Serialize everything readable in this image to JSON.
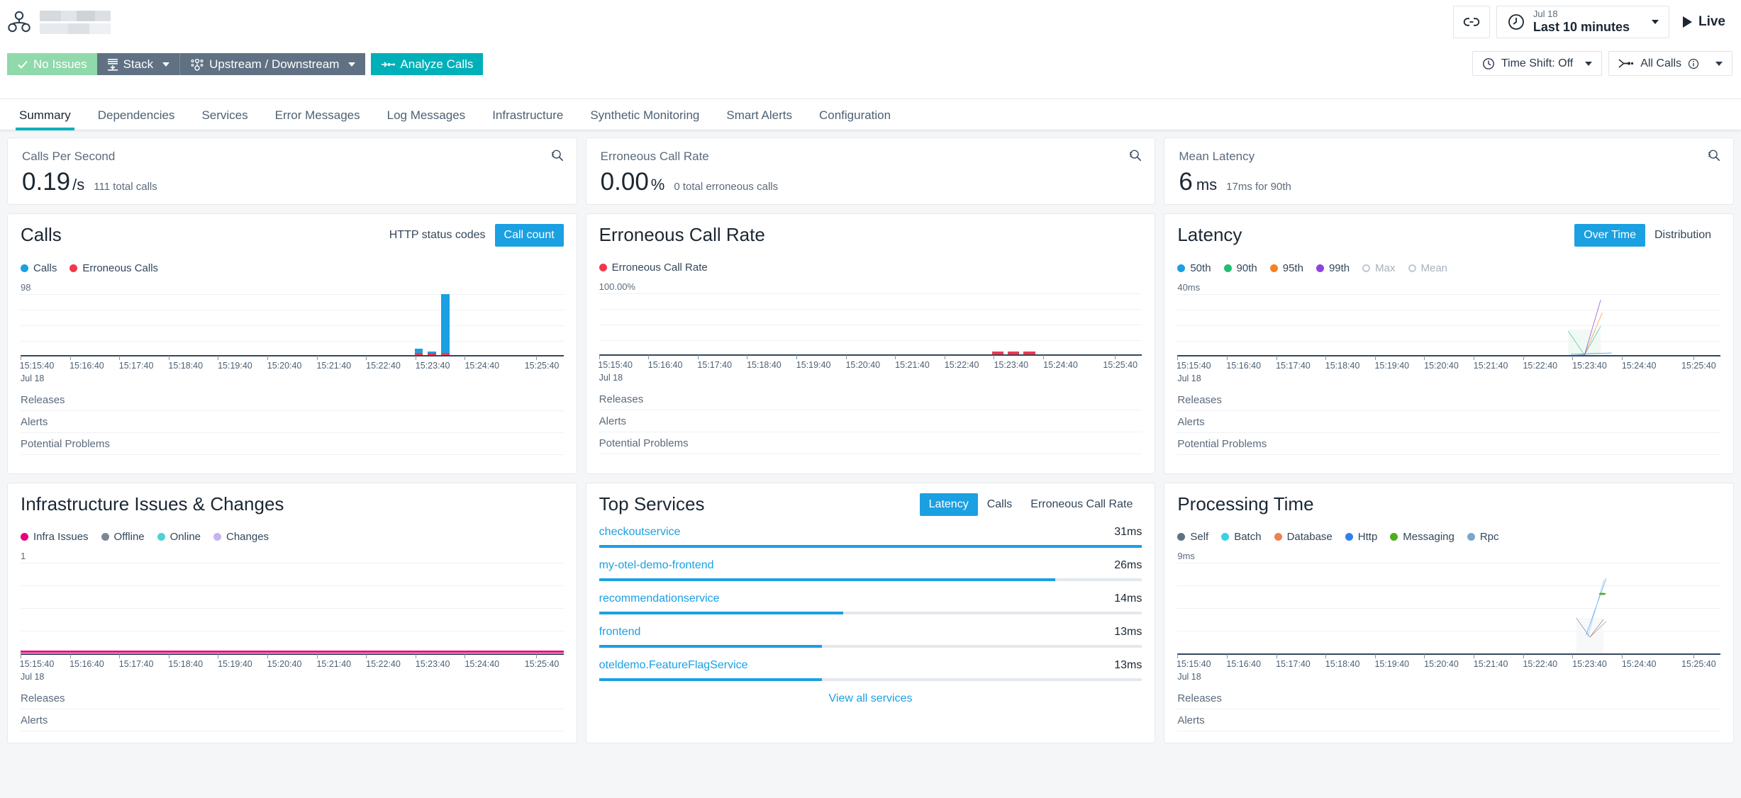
{
  "header": {
    "brand_icon": "service-topology-icon",
    "toolbar": {
      "no_issues_label": "No Issues",
      "stack_label": "Stack",
      "upstream_label": "Upstream / Downstream",
      "analyze_label": "Analyze Calls"
    },
    "right": {
      "link_icon": "chain-link-icon",
      "time_date": "Jul 18",
      "time_range": "Last 10 minutes",
      "live_label": "Live",
      "time_shift_label": "Time Shift: Off",
      "all_calls_label": "All Calls"
    }
  },
  "tabs": [
    {
      "label": "Summary",
      "active": true
    },
    {
      "label": "Dependencies",
      "active": false
    },
    {
      "label": "Services",
      "active": false
    },
    {
      "label": "Error Messages",
      "active": false
    },
    {
      "label": "Log Messages",
      "active": false
    },
    {
      "label": "Infrastructure",
      "active": false
    },
    {
      "label": "Synthetic Monitoring",
      "active": false
    },
    {
      "label": "Smart Alerts",
      "active": false
    },
    {
      "label": "Configuration",
      "active": false
    }
  ],
  "kpis": [
    {
      "title": "Calls Per Second",
      "value": "0.19",
      "unit": "/s",
      "sub": "111 total calls"
    },
    {
      "title": "Erroneous Call Rate",
      "value": "0.00",
      "unit": "%",
      "sub": "0 total erroneous calls"
    },
    {
      "title": "Mean Latency",
      "value": "6",
      "unit": "ms",
      "sub": "17ms for 90th"
    }
  ],
  "calls_card": {
    "title": "Calls",
    "toggles": [
      {
        "label": "HTTP status codes",
        "active": false
      },
      {
        "label": "Call count",
        "active": true
      }
    ],
    "legend": [
      {
        "label": "Calls",
        "color": "#1ba0e2",
        "muted": false
      },
      {
        "label": "Erroneous Calls",
        "color": "#f4364c",
        "muted": false
      }
    ],
    "axis_max": "98",
    "footer": [
      "Releases",
      "Alerts",
      "Potential Problems"
    ]
  },
  "error_card": {
    "title": "Erroneous Call Rate",
    "legend": [
      {
        "label": "Erroneous Call Rate",
        "color": "#f4364c",
        "muted": false
      }
    ],
    "axis_max": "100.00%",
    "footer": [
      "Releases",
      "Alerts",
      "Potential Problems"
    ]
  },
  "latency_card": {
    "title": "Latency",
    "toggles": [
      {
        "label": "Over Time",
        "active": true
      },
      {
        "label": "Distribution",
        "active": false
      }
    ],
    "legend": [
      {
        "label": "50th",
        "color": "#1ba0e2",
        "muted": false
      },
      {
        "label": "90th",
        "color": "#1fbf6e",
        "muted": false
      },
      {
        "label": "95th",
        "color": "#f58220",
        "muted": false
      },
      {
        "label": "99th",
        "color": "#8b44e0",
        "muted": false
      },
      {
        "label": "Max",
        "color": "#bfc8d2",
        "muted": true
      },
      {
        "label": "Mean",
        "color": "#bfc8d2",
        "muted": true
      }
    ],
    "axis_max": "40ms",
    "footer": [
      "Releases",
      "Alerts",
      "Potential Problems"
    ]
  },
  "infra_card": {
    "title": "Infrastructure Issues & Changes",
    "legend": [
      {
        "label": "Infra Issues",
        "color": "#e6007e",
        "muted": false
      },
      {
        "label": "Offline",
        "color": "#7b8794",
        "muted": false
      },
      {
        "label": "Online",
        "color": "#4fd1d9",
        "muted": false
      },
      {
        "label": "Changes",
        "color": "#c6b3f0",
        "muted": false
      }
    ],
    "axis_max": "1",
    "footer": [
      "Releases",
      "Alerts"
    ]
  },
  "top_services": {
    "title": "Top Services",
    "toggles": [
      {
        "label": "Latency",
        "active": true
      },
      {
        "label": "Calls",
        "active": false
      },
      {
        "label": "Erroneous Call Rate",
        "active": false
      }
    ],
    "view_all_label": "View all services"
  },
  "processing_card": {
    "title": "Processing Time",
    "legend": [
      {
        "label": "Self",
        "color": "#5f7183",
        "muted": false
      },
      {
        "label": "Batch",
        "color": "#3ad1e8",
        "muted": false
      },
      {
        "label": "Database",
        "color": "#f0804e",
        "muted": false
      },
      {
        "label": "Http",
        "color": "#2f80ed",
        "muted": false
      },
      {
        "label": "Messaging",
        "color": "#4caf1f",
        "muted": false
      },
      {
        "label": "Rpc",
        "color": "#7ba6c9",
        "muted": false
      }
    ],
    "axis_max": "9ms",
    "footer": [
      "Releases",
      "Alerts"
    ]
  },
  "time_axis": {
    "date": "Jul 18",
    "labels": [
      "15:15:40",
      "15:16:40",
      "15:17:40",
      "15:18:40",
      "15:19:40",
      "15:20:40",
      "15:21:40",
      "15:22:40",
      "15:23:40",
      "15:24:40",
      "15:25:40"
    ]
  },
  "chart_data": [
    {
      "id": "calls",
      "type": "bar",
      "title": "Calls",
      "xlabel": "",
      "ylabel": "Calls",
      "ylim": [
        0,
        98
      ],
      "grid": true,
      "legend_position": "top-left",
      "x": [
        "15:15:40",
        "15:16:40",
        "15:17:40",
        "15:18:40",
        "15:19:40",
        "15:20:40",
        "15:21:40",
        "15:22:40",
        "15:23:40",
        "15:24:40",
        "15:25:40"
      ],
      "series": [
        {
          "name": "Calls",
          "color": "#1ba0e2",
          "points": [
            {
              "t": "15:24:45",
              "v": 9
            },
            {
              "t": "15:25:00",
              "v": 4
            },
            {
              "t": "15:25:15",
              "v": 98
            }
          ]
        },
        {
          "name": "Erroneous Calls",
          "color": "#f4364c",
          "points": [
            {
              "t": "15:24:45",
              "v": 1
            },
            {
              "t": "15:25:00",
              "v": 1
            },
            {
              "t": "15:25:15",
              "v": 1
            }
          ]
        }
      ]
    },
    {
      "id": "erroneous-call-rate",
      "type": "line",
      "title": "Erroneous Call Rate",
      "ylabel": "%",
      "ylim": [
        0,
        100
      ],
      "grid": true,
      "legend_position": "top-left",
      "series": [
        {
          "name": "Erroneous Call Rate",
          "color": "#f4364c",
          "points": [
            {
              "t": "15:24:45",
              "v": 0
            },
            {
              "t": "15:25:00",
              "v": 0
            },
            {
              "t": "15:25:15",
              "v": 0
            }
          ]
        }
      ]
    },
    {
      "id": "latency",
      "type": "line",
      "title": "Latency",
      "ylabel": "ms",
      "ylim": [
        0,
        40
      ],
      "grid": true,
      "legend_position": "top-left",
      "series": [
        {
          "name": "50th",
          "color": "#1ba0e2",
          "points": [
            {
              "t": "15:24:45",
              "v": 1
            },
            {
              "t": "15:25:05",
              "v": 2
            },
            {
              "t": "15:25:20",
              "v": 2
            }
          ]
        },
        {
          "name": "90th",
          "color": "#1fbf6e",
          "points": [
            {
              "t": "15:24:45",
              "v": 13
            },
            {
              "t": "15:25:05",
              "v": 1
            },
            {
              "t": "15:25:20",
              "v": 17
            }
          ]
        },
        {
          "name": "95th",
          "color": "#f58220",
          "points": [
            {
              "t": "15:24:45",
              "v": 1
            },
            {
              "t": "15:25:05",
              "v": 1
            },
            {
              "t": "15:25:20",
              "v": 31
            }
          ]
        },
        {
          "name": "99th",
          "color": "#8b44e0",
          "points": [
            {
              "t": "15:24:45",
              "v": 1
            },
            {
              "t": "15:25:05",
              "v": 1
            },
            {
              "t": "15:25:20",
              "v": 38
            }
          ]
        },
        {
          "name": "Max",
          "color": "#bfc8d2",
          "points": []
        },
        {
          "name": "Mean",
          "color": "#bfc8d2",
          "points": []
        }
      ]
    },
    {
      "id": "infrastructure-issues-changes",
      "type": "line",
      "title": "Infrastructure Issues & Changes",
      "ylim": [
        0,
        1
      ],
      "grid": true,
      "legend_position": "top-left",
      "series": [
        {
          "name": "Infra Issues",
          "color": "#e6007e",
          "constant": 0
        },
        {
          "name": "Offline",
          "color": "#7b8794",
          "constant": 0
        },
        {
          "name": "Online",
          "color": "#4fd1d9",
          "constant": 0
        },
        {
          "name": "Changes",
          "color": "#c6b3f0",
          "constant": 0
        }
      ]
    },
    {
      "id": "top-services",
      "type": "bar",
      "title": "Top Services",
      "orientation": "horizontal",
      "metric": "Latency",
      "categories": [
        "checkoutservice",
        "my-otel-demo-frontend",
        "recommendationservice",
        "frontend",
        "oteldemo.FeatureFlagService"
      ],
      "values": [
        31,
        26,
        14,
        13,
        13
      ],
      "value_labels": [
        "31ms",
        "26ms",
        "14ms",
        "13ms",
        "13ms"
      ],
      "pct": [
        100,
        84,
        45,
        41,
        41
      ],
      "bar_color": "#1ba0e2"
    },
    {
      "id": "processing-time",
      "type": "line",
      "title": "Processing Time",
      "ylabel": "ms",
      "ylim": [
        0,
        9
      ],
      "grid": true,
      "legend_position": "top-left",
      "series": [
        {
          "name": "Self",
          "color": "#5f7183",
          "points": [
            {
              "t": "15:24:55",
              "v": 3.5
            },
            {
              "t": "15:25:10",
              "v": 0.8
            }
          ]
        },
        {
          "name": "Batch",
          "color": "#3ad1e8",
          "points": []
        },
        {
          "name": "Database",
          "color": "#f0804e",
          "points": [
            {
              "t": "15:25:10",
              "v": 0.8
            },
            {
              "t": "15:25:20",
              "v": 3.2
            }
          ]
        },
        {
          "name": "Http",
          "color": "#2f80ed",
          "points": [
            {
              "t": "15:25:08",
              "v": 0.6
            },
            {
              "t": "15:25:22",
              "v": 7.6
            }
          ]
        },
        {
          "name": "Messaging",
          "color": "#4caf1f",
          "points": [
            {
              "t": "15:25:20",
              "v": 6.4
            }
          ]
        },
        {
          "name": "Rpc",
          "color": "#7ba6c9",
          "points": []
        }
      ]
    }
  ]
}
